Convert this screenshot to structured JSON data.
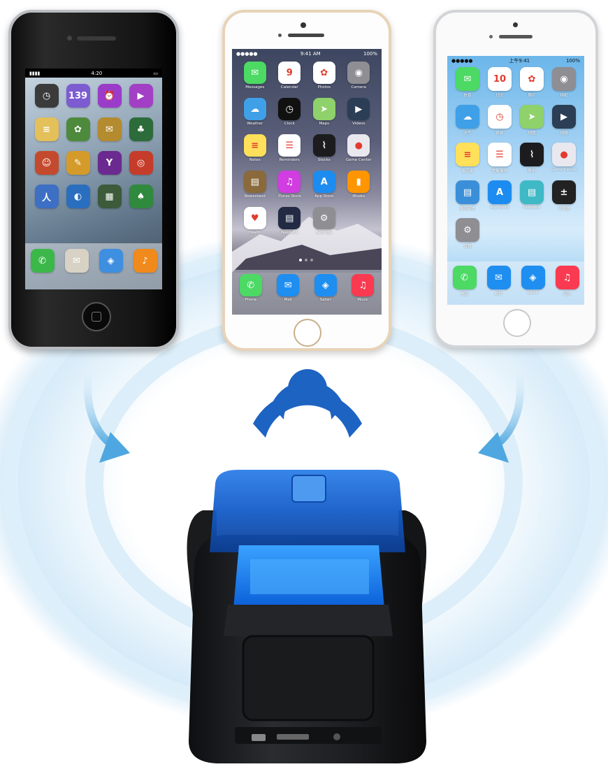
{
  "phone_left": {
    "time": "4:20",
    "grid_apps": [
      {
        "icon": "clock-icon",
        "color": "#3b3b3b",
        "glyph": "◷"
      },
      {
        "icon": "calendar-icon",
        "color": "#7d5bd1",
        "glyph": "139"
      },
      {
        "icon": "alarm-icon",
        "color": "#9b3bc9",
        "glyph": "⏰"
      },
      {
        "icon": "video-icon",
        "color": "#a23fc4",
        "glyph": "▶"
      },
      {
        "icon": "notes-icon",
        "color": "#e3c05a",
        "glyph": "≡"
      },
      {
        "icon": "photos-icon",
        "color": "#4e8a3c",
        "glyph": "✿"
      },
      {
        "icon": "ebook-icon",
        "color": "#b48b2f",
        "glyph": "✉"
      },
      {
        "icon": "game-icon",
        "color": "#2c6b3a",
        "glyph": "♣"
      },
      {
        "icon": "game-icon",
        "color": "#c44a2e",
        "glyph": "☺"
      },
      {
        "icon": "draw-icon",
        "color": "#d49b2a",
        "glyph": "✎"
      },
      {
        "icon": "yahoo-icon",
        "color": "#6b2a8f",
        "glyph": "Y"
      },
      {
        "icon": "target-icon",
        "color": "#c63c2a",
        "glyph": "◎"
      },
      {
        "icon": "social-icon",
        "color": "#3d6fc4",
        "glyph": "人"
      },
      {
        "icon": "globe-icon",
        "color": "#2a6fbf",
        "glyph": "◐"
      },
      {
        "icon": "board-icon",
        "color": "#3d5a3a",
        "glyph": "▦"
      },
      {
        "icon": "cards-icon",
        "color": "#2f8a3e",
        "glyph": "♠"
      }
    ],
    "dock_apps": [
      {
        "icon": "phone-icon",
        "color": "#3cb84a",
        "glyph": "✆"
      },
      {
        "icon": "mail-icon",
        "color": "#d8d2c4",
        "glyph": "✉"
      },
      {
        "icon": "safari-icon",
        "color": "#3e8fe0",
        "glyph": "◈"
      },
      {
        "icon": "ipod-icon",
        "color": "#f08a1c",
        "glyph": "♪"
      }
    ]
  },
  "phone_middle": {
    "time": "9:41 AM",
    "battery": "100%",
    "grid_apps": [
      {
        "label": "Messages",
        "icon": "messages-icon",
        "color": "#4cd964",
        "glyph": "✉"
      },
      {
        "label": "Calendar",
        "icon": "calendar-icon",
        "color": "#ffffff",
        "glyph": "9",
        "dark": true
      },
      {
        "label": "Photos",
        "icon": "photos-icon",
        "color": "#ffffff",
        "glyph": "✿",
        "dark": true
      },
      {
        "label": "Camera",
        "icon": "camera-icon",
        "color": "#8e8e93",
        "glyph": "◉"
      },
      {
        "label": "Weather",
        "icon": "weather-icon",
        "color": "#3fa0e8",
        "glyph": "☁"
      },
      {
        "label": "Clock",
        "icon": "clock-icon",
        "color": "#111111",
        "glyph": "◷"
      },
      {
        "label": "Maps",
        "icon": "maps-icon",
        "color": "#8fd16b",
        "glyph": "➤"
      },
      {
        "label": "Videos",
        "icon": "videos-icon",
        "color": "#2b3e55",
        "glyph": "▶"
      },
      {
        "label": "Notes",
        "icon": "notes-icon",
        "color": "#ffe05a",
        "glyph": "≡",
        "dark": true
      },
      {
        "label": "Reminders",
        "icon": "reminders-icon",
        "color": "#ffffff",
        "glyph": "☰",
        "dark": true
      },
      {
        "label": "Stocks",
        "icon": "stocks-icon",
        "color": "#1c1c1e",
        "glyph": "⌇"
      },
      {
        "label": "Game Center",
        "icon": "game-center-icon",
        "color": "#e8e8ee",
        "glyph": "●",
        "dark": true
      },
      {
        "label": "Newsstand",
        "icon": "newsstand-icon",
        "color": "#8a6a3a",
        "glyph": "▤"
      },
      {
        "label": "iTunes Store",
        "icon": "itunes-icon",
        "color": "#d13de0",
        "glyph": "♫"
      },
      {
        "label": "App Store",
        "icon": "app-store-icon",
        "color": "#1d8cf0",
        "glyph": "A"
      },
      {
        "label": "iBooks",
        "icon": "ibooks-icon",
        "color": "#ff9500",
        "glyph": "▮"
      },
      {
        "label": "Health",
        "icon": "health-icon",
        "color": "#ffffff",
        "glyph": "♥",
        "dark": true
      },
      {
        "label": "Passbook",
        "icon": "passbook-icon",
        "color": "#222a44",
        "glyph": "▤"
      },
      {
        "label": "Settings",
        "icon": "settings-icon",
        "color": "#8e8e93",
        "glyph": "⚙"
      }
    ],
    "dock_apps": [
      {
        "label": "Phone",
        "icon": "phone-icon",
        "color": "#4cd964",
        "glyph": "✆"
      },
      {
        "label": "Mail",
        "icon": "mail-icon",
        "color": "#1e8ef0",
        "glyph": "✉"
      },
      {
        "label": "Safari",
        "icon": "safari-icon",
        "color": "#1e8ef0",
        "glyph": "◈"
      },
      {
        "label": "Music",
        "icon": "music-icon",
        "color": "#fa3a50",
        "glyph": "♫"
      }
    ]
  },
  "phone_right": {
    "time": "上午9:41",
    "battery": "100%",
    "grid_apps": [
      {
        "label": "信息",
        "icon": "messages-icon",
        "color": "#4cd964",
        "glyph": "✉"
      },
      {
        "label": "日历",
        "icon": "calendar-icon",
        "color": "#ffffff",
        "glyph": "10",
        "dark": true
      },
      {
        "label": "照片",
        "icon": "photos-icon",
        "color": "#ffffff",
        "glyph": "✿",
        "dark": true
      },
      {
        "label": "相机",
        "icon": "camera-icon",
        "color": "#8e8e93",
        "glyph": "◉"
      },
      {
        "label": "天气",
        "icon": "weather-icon",
        "color": "#3fa0e8",
        "glyph": "☁"
      },
      {
        "label": "时钟",
        "icon": "clock-icon",
        "color": "#ffffff",
        "glyph": "◷",
        "dark": true
      },
      {
        "label": "地图",
        "icon": "maps-icon",
        "color": "#8fd16b",
        "glyph": "➤"
      },
      {
        "label": "视频",
        "icon": "videos-icon",
        "color": "#2b3e55",
        "glyph": "▶"
      },
      {
        "label": "备忘录",
        "icon": "notes-icon",
        "color": "#ffe05a",
        "glyph": "≡",
        "dark": true
      },
      {
        "label": "提醒事项",
        "icon": "reminders-icon",
        "color": "#ffffff",
        "glyph": "☰",
        "dark": true
      },
      {
        "label": "股市",
        "icon": "stocks-icon",
        "color": "#1c1c1e",
        "glyph": "⌇"
      },
      {
        "label": "Game Center",
        "icon": "game-center-icon",
        "color": "#e8e8ee",
        "glyph": "●",
        "dark": true
      },
      {
        "label": "报刊杂志",
        "icon": "newsstand-icon",
        "color": "#3b8fd8",
        "glyph": "▤"
      },
      {
        "label": "App Store",
        "icon": "app-store-icon",
        "color": "#1d8cf0",
        "glyph": "A"
      },
      {
        "label": "Passbook",
        "icon": "passbook-icon",
        "color": "#3fb9c6",
        "glyph": "▤"
      },
      {
        "label": "计算器",
        "icon": "calculator-icon",
        "color": "#222222",
        "glyph": "±"
      },
      {
        "label": "设置",
        "icon": "settings-icon",
        "color": "#8e8e93",
        "glyph": "⚙"
      }
    ],
    "dock_apps": [
      {
        "label": "电话",
        "icon": "phone-icon",
        "color": "#4cd964",
        "glyph": "✆"
      },
      {
        "label": "邮件",
        "icon": "mail-icon",
        "color": "#1e8ef0",
        "glyph": "✉"
      },
      {
        "label": "Safari",
        "icon": "safari-icon",
        "color": "#1e8ef0",
        "glyph": "◈"
      },
      {
        "label": "音乐",
        "icon": "music-icon",
        "color": "#fa3a50",
        "glyph": "♫"
      }
    ]
  },
  "colors": {
    "wave_blue": "#1c64c4",
    "arrow_blue": "#5cb4e6",
    "printer_body": "#1e1f22",
    "printer_cover": "#1f6fd8",
    "halo": "#d7ecf9"
  }
}
